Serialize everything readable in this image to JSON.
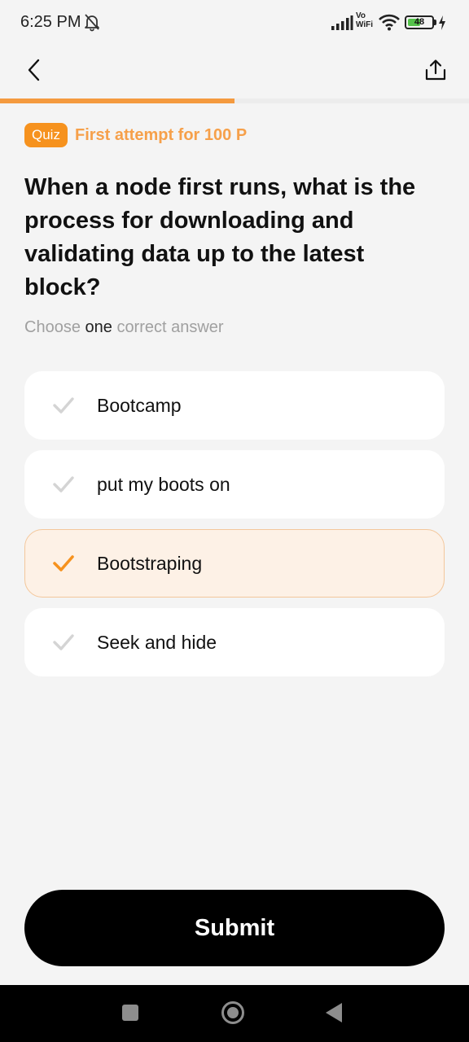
{
  "status_bar": {
    "time": "6:25 PM",
    "network_label": "Vo\nWiFi",
    "battery": "48"
  },
  "progress_percent": 50,
  "quiz": {
    "badge": "Quiz",
    "attempt_text": "First attempt for 100 P",
    "question": "When a node first runs, what is the process for downloading and validating data up to the latest block?",
    "instruction": {
      "prefix": "Choose",
      "emphasis": "one",
      "suffix": "correct answer"
    },
    "options": [
      {
        "label": "Bootcamp",
        "selected": false
      },
      {
        "label": "put my boots on",
        "selected": false
      },
      {
        "label": "Bootstraping",
        "selected": true
      },
      {
        "label": "Seek and hide",
        "selected": false
      }
    ]
  },
  "submit_label": "Submit",
  "colors": {
    "accent": "#f6921e",
    "selected_bg": "#fdf1e6",
    "background": "#f4f4f4"
  },
  "icons": {
    "back": "chevron-left-icon",
    "share": "share-upload-icon",
    "check": "checkmark-icon"
  }
}
